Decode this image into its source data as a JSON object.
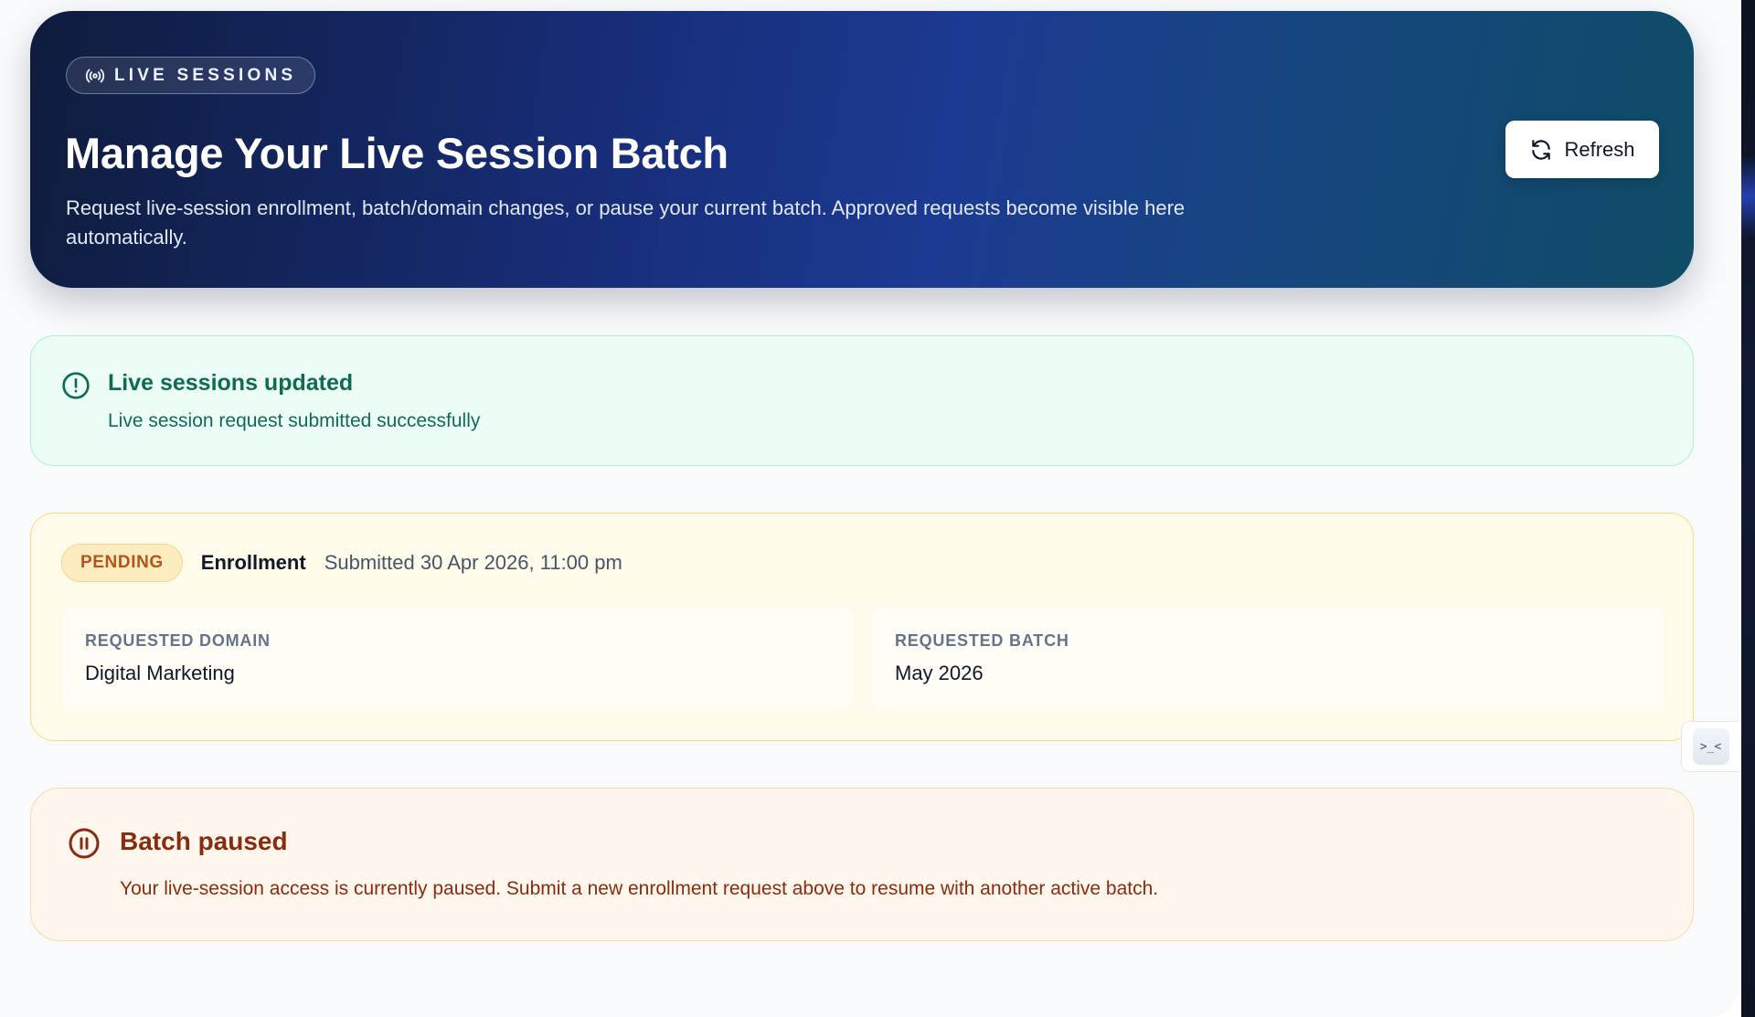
{
  "header": {
    "badge_label": "LIVE SESSIONS",
    "badge_icon": "broadcast-icon",
    "title": "Manage Your Live Session Batch",
    "description": "Request live-session enrollment, batch/domain changes, or pause your current batch. Approved requests become visible here automatically.",
    "refresh_label": "Refresh",
    "refresh_icon": "refresh-icon"
  },
  "success_alert": {
    "icon": "alert-circle-icon",
    "title": "Live sessions updated",
    "message": "Live session request submitted successfully",
    "accent_color": "#0f6b52"
  },
  "request": {
    "status": "PENDING",
    "status_color": "#b4531a",
    "type": "Enrollment",
    "submitted": "Submitted 30 Apr 2026, 11:00 pm",
    "fields": [
      {
        "label": "REQUESTED DOMAIN",
        "value": "Digital Marketing"
      },
      {
        "label": "REQUESTED BATCH",
        "value": "May 2026"
      }
    ]
  },
  "paused_notice": {
    "icon": "pause-circle-icon",
    "title": "Batch paused",
    "message": "Your live-session access is currently paused. Submit a new enrollment request above to resume with another active batch.",
    "accent_color": "#8a2b0f"
  },
  "side_tab": {
    "icon": "dev-tools-icon",
    "glyph": ">_<"
  }
}
